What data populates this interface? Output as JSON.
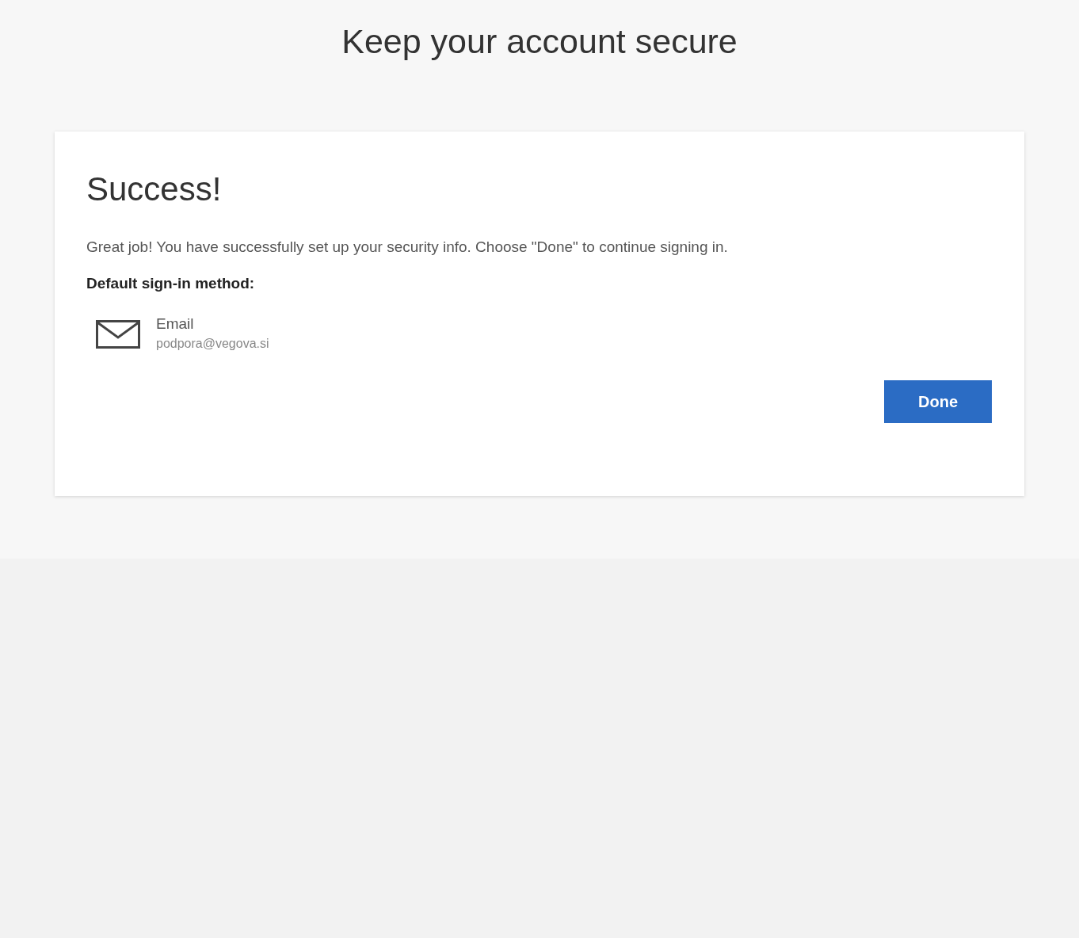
{
  "page": {
    "title": "Keep your account secure"
  },
  "card": {
    "heading": "Success!",
    "message": "Great job! You have successfully set up your security info. Choose \"Done\" to continue signing in.",
    "default_label": "Default sign-in method:",
    "method": {
      "name": "Email",
      "detail": "podpora@vegova.si"
    },
    "button": "Done"
  }
}
